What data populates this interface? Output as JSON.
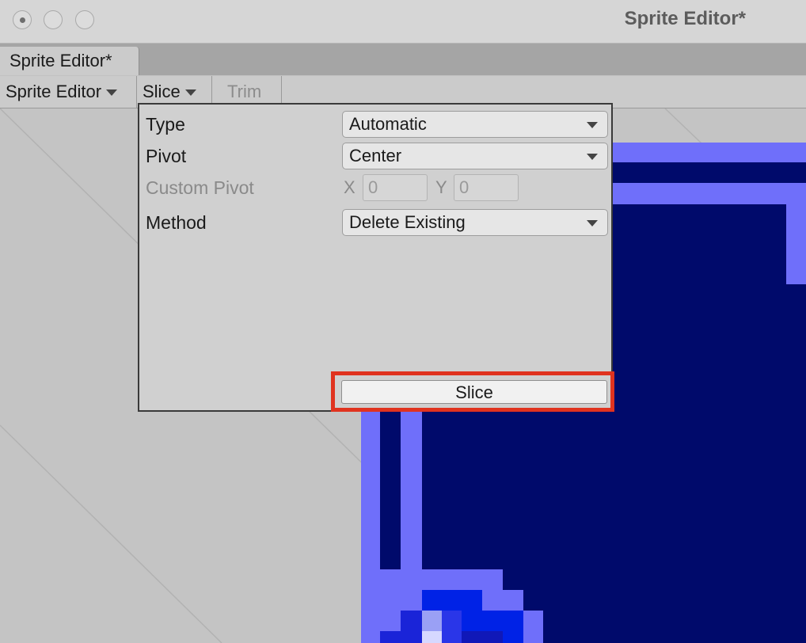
{
  "window": {
    "title": "Sprite Editor*"
  },
  "tabs": [
    {
      "label": "Sprite Editor*"
    }
  ],
  "toolbar": {
    "mode_label": "Sprite Editor",
    "slice_label": "Slice",
    "trim_label": "Trim"
  },
  "slice_popup": {
    "type": {
      "label": "Type",
      "value": "Automatic"
    },
    "pivot": {
      "label": "Pivot",
      "value": "Center"
    },
    "custom_pivot": {
      "label": "Custom Pivot",
      "x_label": "X",
      "x_value": "0",
      "y_label": "Y",
      "y_value": "0"
    },
    "method": {
      "label": "Method",
      "value": "Delete Existing"
    },
    "slice_button": "Slice"
  },
  "colors": {
    "highlight": "#e0331f",
    "sprite_dark": "#000a6b",
    "sprite_light": "#6f6ffa",
    "sprite_blue": "#0022e6"
  }
}
